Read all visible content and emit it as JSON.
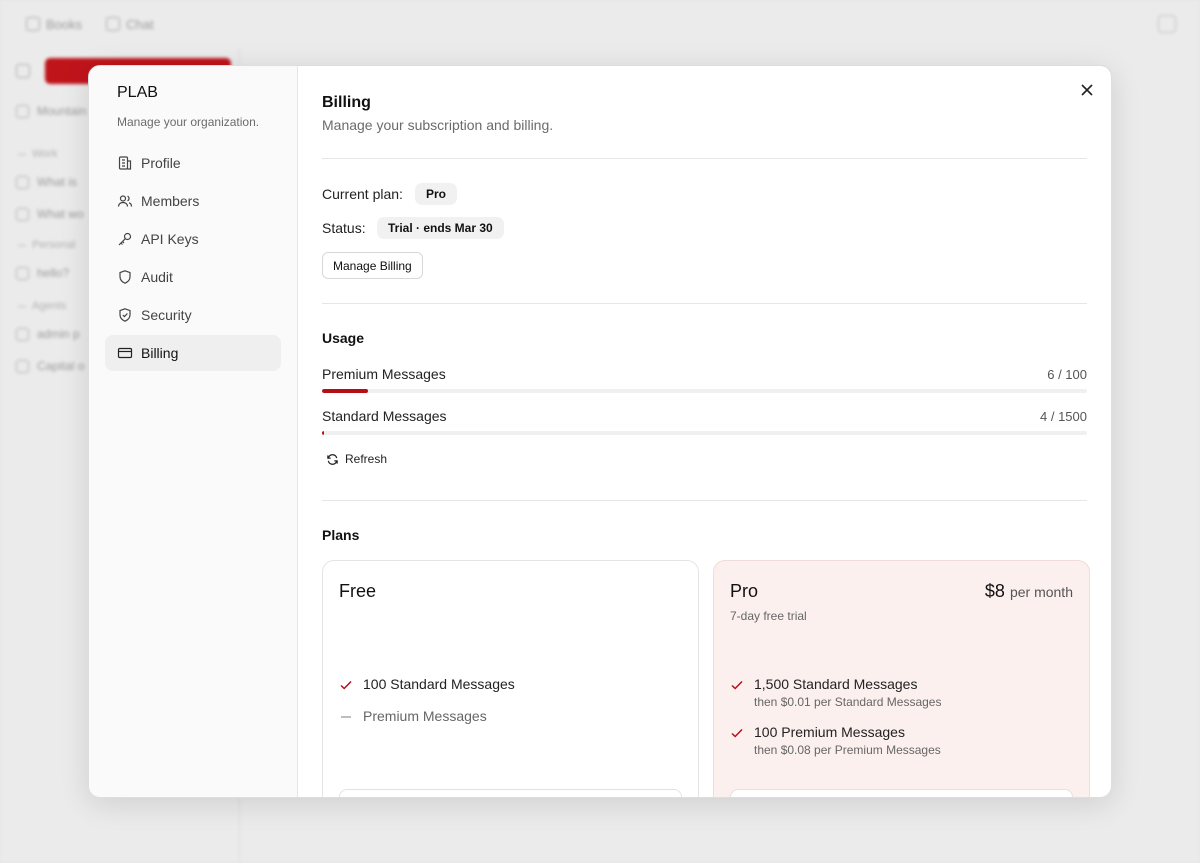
{
  "background": {
    "tabs": [
      "Books",
      "Chat"
    ],
    "sections": [
      "Work",
      "Personal",
      "Agents"
    ],
    "items": [
      "What is",
      "What wo",
      "hello?",
      "admin p",
      "Capital o"
    ],
    "workspace": "Mountain"
  },
  "sidebar": {
    "org_name": "PLAB",
    "org_sub": "Manage your organization.",
    "items": [
      {
        "label": "Profile",
        "icon": "building-icon"
      },
      {
        "label": "Members",
        "icon": "users-icon"
      },
      {
        "label": "API Keys",
        "icon": "key-icon"
      },
      {
        "label": "Audit",
        "icon": "shield-icon"
      },
      {
        "label": "Security",
        "icon": "shield-check-icon"
      },
      {
        "label": "Billing",
        "icon": "credit-card-icon"
      }
    ],
    "active": "Billing"
  },
  "billing": {
    "title": "Billing",
    "subtitle": "Manage your subscription and billing.",
    "current_plan_label": "Current plan:",
    "current_plan": "Pro",
    "status_label": "Status:",
    "status": "Trial · ends Mar 30",
    "manage_button": "Manage Billing"
  },
  "usage": {
    "heading": "Usage",
    "rows": [
      {
        "name": "Premium Messages",
        "value": "6 / 100",
        "used": 6,
        "total": 100
      },
      {
        "name": "Standard Messages",
        "value": "4 / 1500",
        "used": 4,
        "total": 1500
      }
    ],
    "refresh_label": "Refresh"
  },
  "plans": {
    "heading": "Plans",
    "free": {
      "name": "Free",
      "features": [
        {
          "text": "100 Standard Messages",
          "included": true
        },
        {
          "text": "Premium Messages",
          "included": false
        }
      ]
    },
    "pro": {
      "name": "Pro",
      "price": "$8",
      "per": "per month",
      "note": "7-day free trial",
      "features": [
        {
          "text": "1,500 Standard Messages",
          "sub": "then $0.01 per Standard Messages"
        },
        {
          "text": "100 Premium Messages",
          "sub": "then $0.08 per Premium Messages"
        }
      ]
    }
  },
  "colors": {
    "accent": "#b50f16",
    "pro_card": "#fbf0ee"
  }
}
